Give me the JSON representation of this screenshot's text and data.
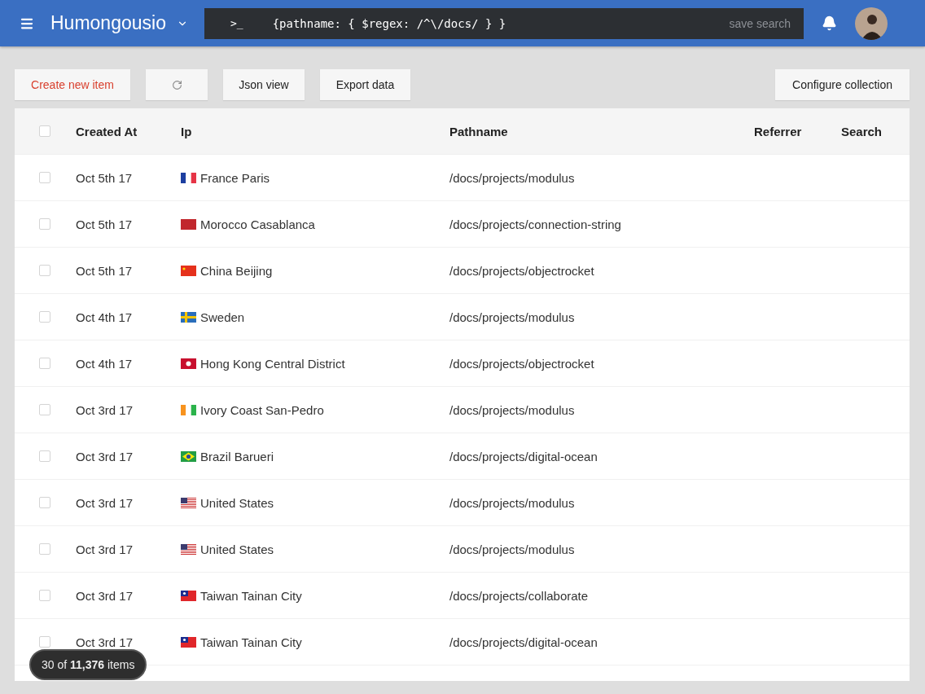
{
  "app_bar": {
    "title": "Humongousio",
    "query": "{pathname: { $regex: /^\\/docs/ } }",
    "prompt": ">_",
    "save_label": "save search"
  },
  "toolbar": {
    "create": "Create new item",
    "json_view": "Json view",
    "export": "Export data",
    "configure": "Configure collection"
  },
  "table": {
    "all_selected": false,
    "columns": [
      "Created At",
      "Ip",
      "Pathname",
      "Referrer",
      "Search"
    ],
    "rows": [
      {
        "selected": false,
        "kind": "france",
        "created": "Oct 5th 17",
        "ip": "France Paris",
        "path": "/docs/projects/modulus"
      },
      {
        "selected": false,
        "kind": "morocco",
        "created": "Oct 5th 17",
        "ip": "Morocco Casablanca",
        "path": "/docs/projects/connection-string"
      },
      {
        "selected": false,
        "kind": "china",
        "created": "Oct 5th 17",
        "ip": "China Beijing",
        "path": "/docs/projects/objectrocket"
      },
      {
        "selected": false,
        "kind": "sweden",
        "created": "Oct 4th 17",
        "ip": "Sweden",
        "path": "/docs/projects/modulus"
      },
      {
        "selected": false,
        "kind": "hongkong",
        "created": "Oct 4th 17",
        "ip": "Hong Kong Central District",
        "path": "/docs/projects/objectrocket"
      },
      {
        "selected": false,
        "kind": "ivorycoast",
        "created": "Oct 3rd 17",
        "ip": "Ivory Coast San-Pedro",
        "path": "/docs/projects/modulus"
      },
      {
        "selected": false,
        "kind": "brazil",
        "created": "Oct 3rd 17",
        "ip": "Brazil Barueri",
        "path": "/docs/projects/digital-ocean"
      },
      {
        "selected": false,
        "kind": "usa",
        "created": "Oct 3rd 17",
        "ip": "United States",
        "path": "/docs/projects/modulus"
      },
      {
        "selected": false,
        "kind": "usa",
        "created": "Oct 3rd 17",
        "ip": "United States",
        "path": "/docs/projects/modulus"
      },
      {
        "selected": false,
        "kind": "taiwan",
        "created": "Oct 3rd 17",
        "ip": "Taiwan Tainan City",
        "path": "/docs/projects/collaborate"
      },
      {
        "selected": false,
        "kind": "taiwan",
        "created": "Oct 3rd 17",
        "ip": "Taiwan Tainan City",
        "path": "/docs/projects/digital-ocean"
      }
    ]
  },
  "count_badge": "30 of **11,376** items"
}
